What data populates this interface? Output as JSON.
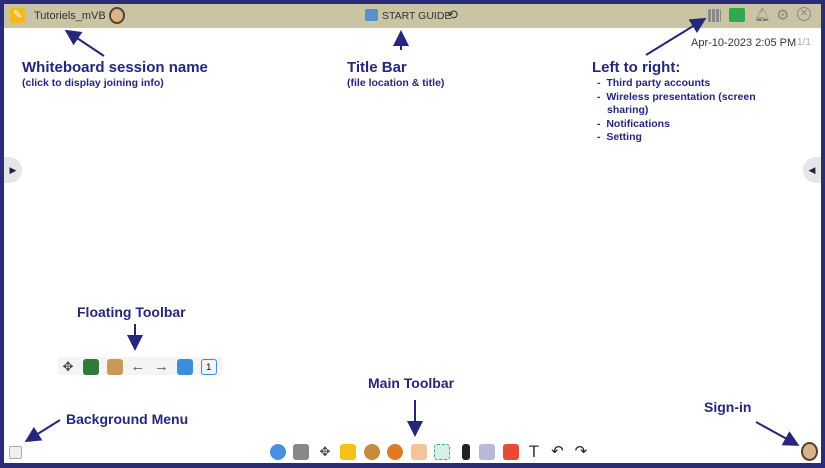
{
  "titlebar": {
    "session_name": "Tutoriels_mVB",
    "title": "START GUIDE",
    "datetime": "Apr-10-2023 2:05 PM",
    "page": "1/1"
  },
  "annotations": {
    "session": {
      "heading": "Whiteboard session name",
      "sub": "(click to display joining info)"
    },
    "title": {
      "heading": "Title Bar",
      "sub": "(file location & title)"
    },
    "right": {
      "heading": "Left to right:",
      "items": [
        "Third party accounts",
        "Wireless presentation (screen sharing)",
        "Notifications",
        "Setting"
      ]
    },
    "floating": "Floating Toolbar",
    "main": "Main Toolbar",
    "background": "Background Menu",
    "signin": "Sign-in"
  },
  "colors": {
    "frame": "#2b2b7c",
    "titlebar": "#c9c4a3",
    "annotation": "#26267a"
  }
}
